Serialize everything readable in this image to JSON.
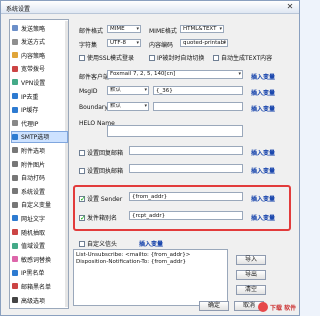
{
  "window": {
    "title": "系统设置",
    "close_icon": "close-icon"
  },
  "sidebar": {
    "items": [
      {
        "label": "发送策略",
        "icon_color": "#6b8fc9",
        "selected": false
      },
      {
        "label": "发送方式",
        "icon_color": "#8f8f8f",
        "selected": false
      },
      {
        "label": "内容策略",
        "icon_color": "#e0a53a",
        "selected": false
      },
      {
        "label": "宽带拨号",
        "icon_color": "#c44",
        "selected": false
      },
      {
        "label": "VPN设置",
        "icon_color": "#4a8",
        "selected": false
      },
      {
        "label": "IP去重",
        "icon_color": "#2d7bd1",
        "selected": false
      },
      {
        "label": "IP缓存",
        "icon_color": "#2d7bd1",
        "selected": false
      },
      {
        "label": "代理IP",
        "icon_color": "#888",
        "selected": false
      },
      {
        "label": "SMTP选项",
        "icon_color": "#2d7bd1",
        "selected": true
      },
      {
        "label": "附件选项",
        "icon_color": "#777",
        "selected": false
      },
      {
        "label": "附件图片",
        "icon_color": "#777",
        "selected": false
      },
      {
        "label": "自动打码",
        "icon_color": "#777",
        "selected": false
      },
      {
        "label": "系统设置",
        "icon_color": "#777",
        "selected": false
      },
      {
        "label": "自定义变量",
        "icon_color": "#777",
        "selected": false
      },
      {
        "label": "网址文字",
        "icon_color": "#2d7bd1",
        "selected": false
      },
      {
        "label": "随机抽取",
        "icon_color": "#c44",
        "selected": false
      },
      {
        "label": "值域设置",
        "icon_color": "#4a8",
        "selected": false
      },
      {
        "label": "敏感词替换",
        "icon_color": "#d6a",
        "selected": false
      },
      {
        "label": "IP黑名单",
        "icon_color": "#2d7bd1",
        "selected": false
      },
      {
        "label": "邮箱黑名单",
        "icon_color": "#c44",
        "selected": false
      },
      {
        "label": "高级选项",
        "icon_color": "#444",
        "selected": false
      }
    ]
  },
  "mail": {
    "format_label": "邮件格式",
    "format_value": "MIME",
    "mime_format_label": "MIME格式",
    "mime_format_value": "HTML&TEXT",
    "charset_label": "字符集",
    "charset_value": "UTF-8",
    "content_encoding_label": "内容编码",
    "content_encoding_value": "quoted-printabl",
    "ssl_label": "使用SSL模式登录",
    "ip_deep_label": "IP被封时自动切换",
    "auto_text_label": "自动生成TEXT内容"
  },
  "client": {
    "label": "邮件客户端",
    "value": "Foxmail 7, 2, 5, 140[cn]",
    "insert": "插入变量"
  },
  "msgid": {
    "label": "MsgID",
    "select": "默认",
    "value": "{_36}",
    "insert": "插入变量"
  },
  "boundary": {
    "label": "Boundary",
    "select": "默认",
    "value": "",
    "insert": "插入变量"
  },
  "helo": {
    "label": "HELO Name",
    "value": ""
  },
  "reply": {
    "label": "设置回复邮箱",
    "value": "",
    "insert": "插入变量"
  },
  "bounce": {
    "label": "设置回执邮箱",
    "value": "",
    "insert": "插入变量"
  },
  "sender": {
    "label": "设置 Sender",
    "value": "{from_addr}",
    "insert": "插入变量",
    "checked": true
  },
  "rcpt_alias": {
    "label": "发件箱别名",
    "value": "{rcpt_addr}",
    "insert": "插入变量",
    "checked": true
  },
  "custom_header": {
    "label": "自定义信头",
    "insert": "插入变量",
    "text": "List-Unsubscribe: <mailto: {from_addr}>\nDisposition-Notification-To: {from_addr}"
  },
  "buttons": {
    "import": "导入",
    "export": "导出",
    "clear": "清空",
    "ok": "确定",
    "cancel": "取消"
  },
  "watermark": {
    "text": "下载  软件"
  }
}
